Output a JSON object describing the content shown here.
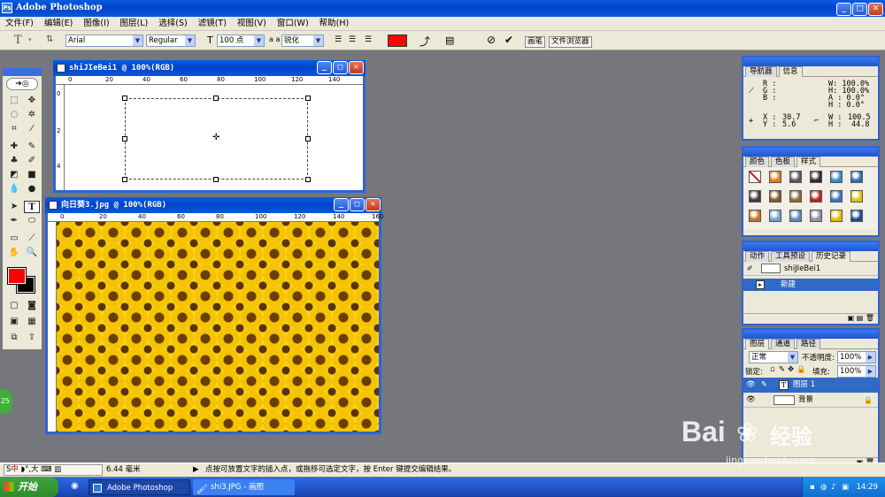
{
  "app_title": "Adobe Photoshop",
  "menu": [
    "文件(F)",
    "编辑(E)",
    "图像(I)",
    "图层(L)",
    "选择(S)",
    "滤镜(T)",
    "视图(V)",
    "窗口(W)",
    "帮助(H)"
  ],
  "options": {
    "font_family": "Arial",
    "font_style": "Regular",
    "font_size": "100 点",
    "aa_label": "a a",
    "aa_value": "锐化",
    "color": "#ff0000",
    "palette_well": [
      "画笔",
      "文件浏览器"
    ]
  },
  "doc1": {
    "title": "shiJIeBei1 @ 100%(RGB)",
    "ruler": [
      "0",
      "20",
      "40",
      "60",
      "80",
      "100",
      "120",
      "140"
    ]
  },
  "doc2": {
    "title": "向日葵3.jpg @ 100%(RGB)",
    "ruler": [
      "0",
      "20",
      "40",
      "60",
      "80",
      "100",
      "120",
      "140",
      "160"
    ]
  },
  "vruler": [
    "0",
    "2",
    "4"
  ],
  "colors": {
    "fg": "#ff0000",
    "bg": "#000000"
  },
  "navigator": {
    "tabs": [
      "导航器",
      "信息"
    ],
    "r": "R :",
    "g": "G :",
    "b": "B :",
    "x_label": "X :",
    "x": "30.7",
    "y_label": "Y :",
    "y": "5.6",
    "w_pct": "W: 100.0%",
    "h_pct": "H: 100.0%",
    "a": "A :  0.0°",
    "h_deg": "H :  0.0°",
    "w_label": "W :",
    "w": "100.5",
    "h_label": "H :",
    "h": "44.8"
  },
  "swatches_tabs": [
    "颜色",
    "色板",
    "样式"
  ],
  "history": {
    "tabs": [
      "动作",
      "工具预设",
      "历史记录"
    ],
    "items": [
      "shiJIeBei1",
      "新建"
    ]
  },
  "layers": {
    "tabs": [
      "图层",
      "通道",
      "路径"
    ],
    "mode": "正常",
    "opacity_label": "不透明度:",
    "opacity": "100%",
    "lock_label": "锁定:",
    "fill_label": "填充:",
    "fill": "100%",
    "items": [
      "图层 1",
      "背景"
    ]
  },
  "status": {
    "ime": "中",
    "zoom": "6.44 毫米",
    "hint": "点按可放置文字的插入点，或拖移可选定文字，按 Enter 键提交编辑结果。"
  },
  "taskbar": {
    "start": "开始",
    "items": [
      "Adobe Photoshop",
      "shi3.JPG - 画图"
    ],
    "time": "14:29"
  },
  "watermark": {
    "brand": "Bai",
    "brand2": "经验",
    "url": "jingyan.baidu.com"
  }
}
